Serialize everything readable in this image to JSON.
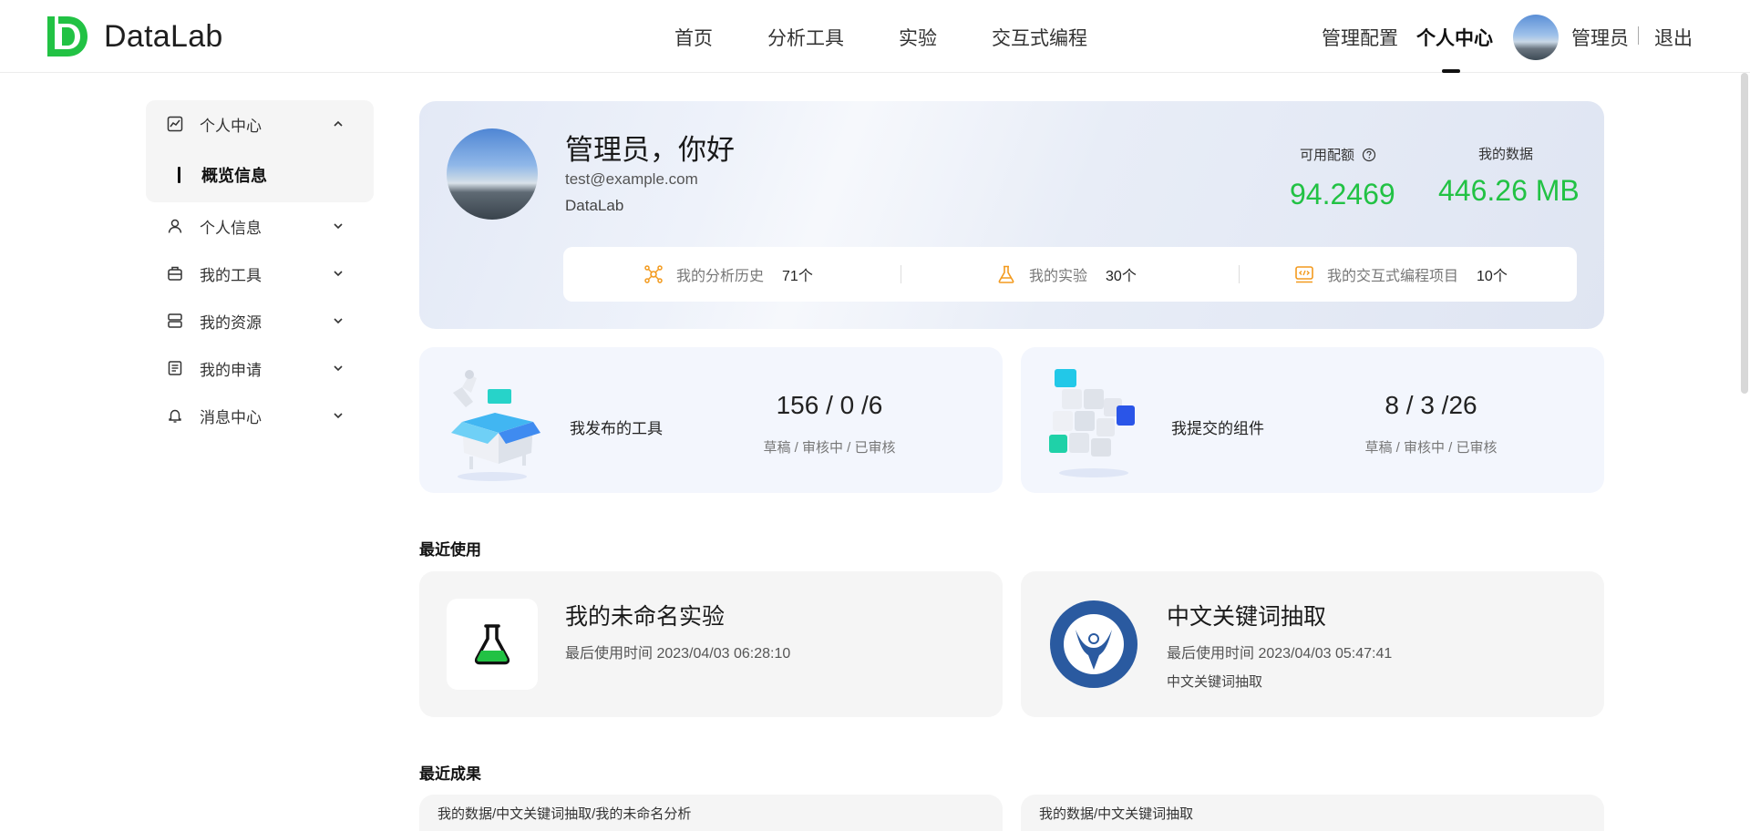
{
  "app": {
    "name": "DataLab",
    "brand_color": "#22c244"
  },
  "nav": {
    "items": [
      "首页",
      "分析工具",
      "实验",
      "交互式编程"
    ],
    "right": {
      "admin_config": "管理配置",
      "personal_center": "个人中心",
      "user": "管理员",
      "logout": "退出"
    }
  },
  "sidebar": {
    "group": {
      "label": "个人中心",
      "icon": "chart-icon",
      "expanded": true,
      "sub": "概览信息"
    },
    "items": [
      {
        "label": "个人信息",
        "icon": "user-icon"
      },
      {
        "label": "我的工具",
        "icon": "toolbox-icon"
      },
      {
        "label": "我的资源",
        "icon": "storage-icon"
      },
      {
        "label": "我的申请",
        "icon": "form-icon"
      },
      {
        "label": "消息中心",
        "icon": "bell-icon"
      }
    ]
  },
  "profile": {
    "greeting": "管理员，你好",
    "email": "test@example.com",
    "org": "DataLab",
    "quota_label": "可用配额",
    "quota_value": "94.2469",
    "data_label": "我的数据",
    "data_value": "446.26 MB",
    "stats": [
      {
        "label": "我的分析历史",
        "value": "71个",
        "icon": "network-icon"
      },
      {
        "label": "我的实验",
        "value": "30个",
        "icon": "flask-icon"
      },
      {
        "label": "我的交互式编程项目",
        "value": "10个",
        "icon": "code-icon"
      }
    ]
  },
  "published": [
    {
      "title": "我发布的工具",
      "counts": "156 / 0 /6",
      "legend": "草稿 / 审核中 / 已审核"
    },
    {
      "title": "我提交的组件",
      "counts": "8 / 3 /26",
      "legend": "草稿 / 审核中 / 已审核"
    }
  ],
  "recent": {
    "title": "最近使用",
    "items": [
      {
        "title": "我的未命名实验",
        "time": "最后使用时间 2023/04/03 06:28:10",
        "desc": "",
        "icon": "flask-icon"
      },
      {
        "title": "中文关键词抽取",
        "time": "最后使用时间 2023/04/03 05:47:41",
        "desc": "中文关键词抽取",
        "icon": "institute-logo-icon"
      }
    ]
  },
  "results": {
    "title": "最近成果",
    "items": [
      "我的数据/中文关键词抽取/我的未命名分析",
      "我的数据/中文关键词抽取"
    ]
  }
}
